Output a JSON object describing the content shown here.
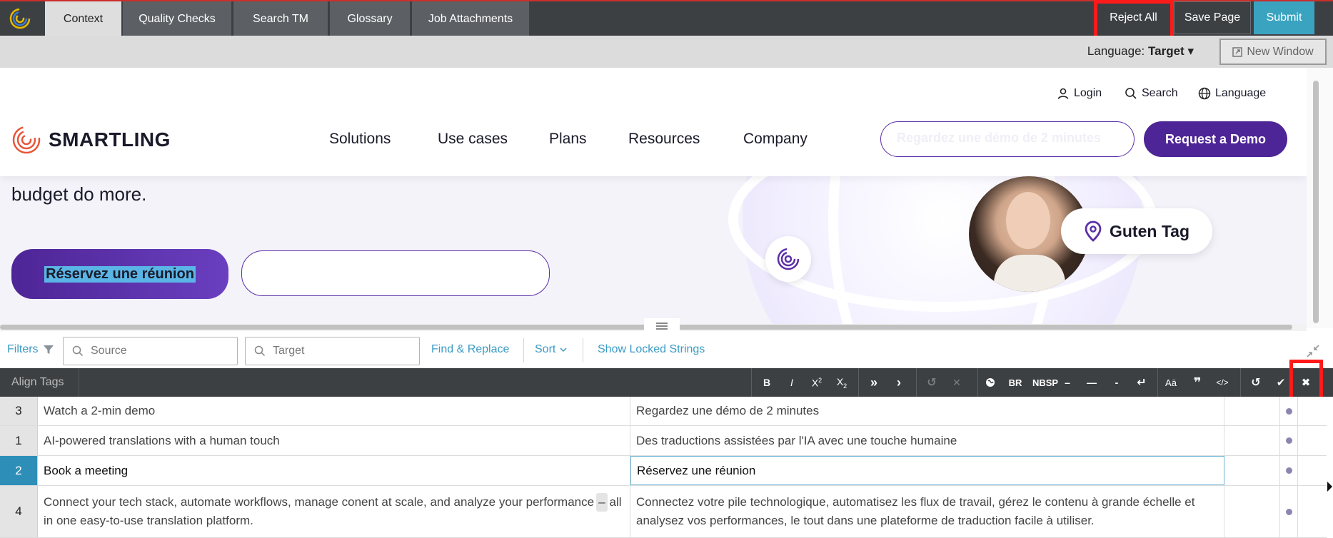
{
  "tabs": [
    {
      "label": "Context"
    },
    {
      "label": "Quality Checks"
    },
    {
      "label": "Search TM"
    },
    {
      "label": "Glossary"
    },
    {
      "label": "Job Attachments"
    }
  ],
  "actions": {
    "reject_all": "Reject All",
    "save_page": "Save Page",
    "submit": "Submit"
  },
  "language": {
    "label": "Language:",
    "value": "Target",
    "new_window": "New Window"
  },
  "site": {
    "brand": "SMARTLING",
    "util": {
      "login": "Login",
      "search": "Search",
      "language": "Language"
    },
    "nav": [
      "Solutions",
      "Use cases",
      "Plans",
      "Resources",
      "Company"
    ],
    "ghost_cta": "Regardez une démo de 2 minutes",
    "request_demo": "Request a Demo",
    "hero_text": "budget do more.",
    "book_cta": "Réservez une réunion",
    "bubble": "Guten Tag"
  },
  "filters": {
    "filters_label": "Filters",
    "source_placeholder": "Source",
    "target_placeholder": "Target",
    "find_replace": "Find & Replace",
    "sort": "Sort",
    "show_locked": "Show Locked Strings"
  },
  "toolbar": {
    "align_tags": "Align Tags",
    "bold": "B",
    "italic": "I",
    "br": "BR",
    "nbsp": "NBSP"
  },
  "rows": [
    {
      "num": "3",
      "source": "Watch a 2-min demo",
      "target": "Regardez une démo de 2 minutes"
    },
    {
      "num": "1",
      "source": "AI-powered translations with a human touch",
      "target": "Des traductions assistées par l'IA avec une touche humaine"
    },
    {
      "num": "2",
      "source": "Book a meeting",
      "target": "Réservez une réunion"
    },
    {
      "num": "4",
      "source_a": "Connect your tech stack, automate workflows, manage conent at scale, and analyze your performance",
      "source_tag": "–",
      "source_b": "all in one easy-to-use translation platform.",
      "target": "Connectez votre pile technologique, automatisez les flux de travail, gérez le contenu à grande échelle et analysez vos performances, le tout dans une plateforme de traduction facile à utiliser."
    }
  ],
  "colors": {
    "topbar": "#3d4043",
    "submit": "#3aa3c0",
    "highlight": "#ff1a1a",
    "brand_purple": "#4e2596",
    "active_row": "#2d8fb8"
  }
}
